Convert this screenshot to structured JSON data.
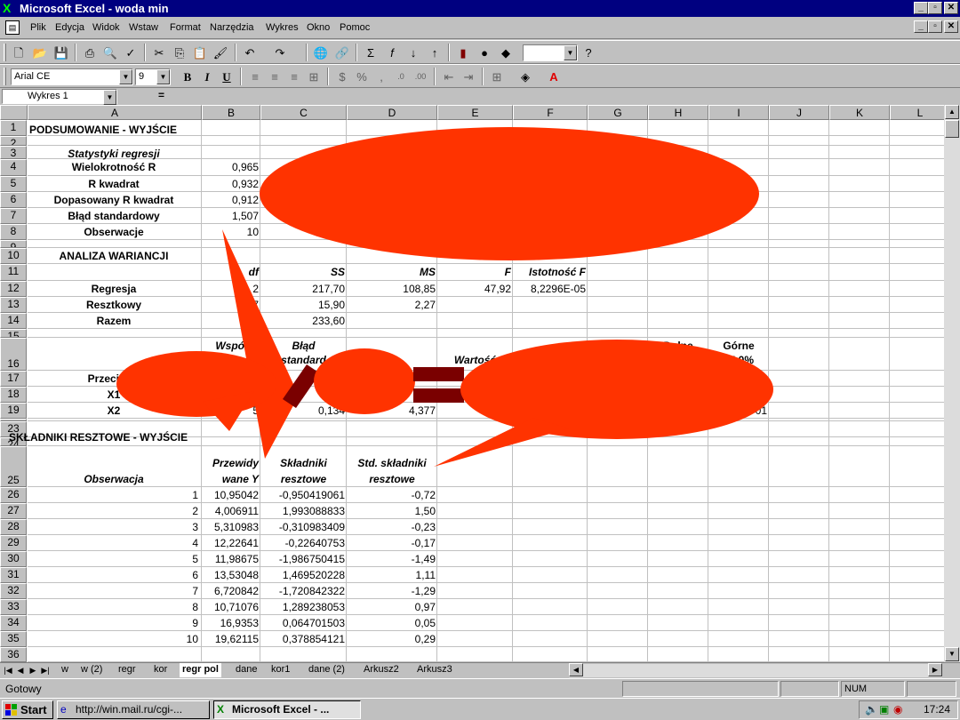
{
  "window": {
    "title": "Microsoft Excel - woda min",
    "minimize": "_",
    "maximize": "▫",
    "close": "✕"
  },
  "menu": [
    "Plik",
    "Edycja",
    "Widok",
    "Wstaw",
    "Format",
    "Narzędzia",
    "Wykres",
    "Okno",
    "Pomoc"
  ],
  "formatting": {
    "font": "Arial CE",
    "size": "9",
    "bold": "B",
    "italic": "I",
    "underline": "U"
  },
  "namebox": "Wykres 1",
  "formula_equals": "=",
  "columns": [
    "A",
    "B",
    "C",
    "D",
    "E",
    "F",
    "G",
    "H",
    "I",
    "J",
    "K",
    "L"
  ],
  "rows": [
    "1",
    "2",
    "3",
    "4",
    "5",
    "6",
    "7",
    "8",
    "9",
    "10",
    "11",
    "12",
    "13",
    "14",
    "15",
    "16",
    "17",
    "18",
    "19",
    "20",
    "23",
    "24",
    "25",
    "26",
    "27",
    "28",
    "29",
    "30",
    "31",
    "32",
    "33",
    "34",
    "35",
    "36"
  ],
  "cells": {
    "a1": "PODSUMOWANIE - WYJŚCIE",
    "a3": "Statystyki regresji",
    "a4": "Wielokrotność R",
    "b4": "0,965",
    "a5": "R kwadrat",
    "b5": "0,932",
    "a6": "Dopasowany R kwadrat",
    "b6": "0,912",
    "a7": "Błąd standardowy",
    "b7": "1,507",
    "a8": "Obserwacje",
    "b8": "10",
    "a10": "ANALIZA WARIANCJI",
    "b11": "df",
    "c11": "SS",
    "d11": "MS",
    "e11": "F",
    "f11": "Istotność F",
    "a12": "Regresja",
    "b12": "2",
    "c12": "217,70",
    "d12": "108,85",
    "e12": "47,92",
    "f12": "8,2296E-05",
    "a13": "Resztkowy",
    "b13": "7",
    "c13": "15,90",
    "d13": "2,27",
    "a14": "Razem",
    "b14": "9",
    "c14": "233,60",
    "b16a": "Współcz",
    "c16a": "Błąd",
    "c16b": "standard",
    "e16": "Wartość",
    "g16": "Górne",
    "h16": "Dolne",
    "i16a": "Górne",
    "i16b": "95,0%",
    "a17": "Przecięcie",
    "a18": "X1",
    "b18": "2,",
    "c18": "21",
    "a19": "X2",
    "b19": "5",
    "c19": "0,134",
    "d19": "4,377",
    "i19": "01",
    "a23": "SKŁADNIKI RESZTOWE - WYJŚCIE",
    "b25a": "Przewidy",
    "b25b": "wane Y",
    "c25a": "Składniki",
    "c25b": "resztowe",
    "d25a": "Std. składniki",
    "d25b": "resztowe",
    "a25": "Obserwacja"
  },
  "residuals": [
    {
      "obs": "1",
      "pred": "10,95042",
      "res": "-0,950419061",
      "std": "-0,72"
    },
    {
      "obs": "2",
      "pred": "4,006911",
      "res": "1,993088833",
      "std": "1,50"
    },
    {
      "obs": "3",
      "pred": "5,310983",
      "res": "-0,310983409",
      "std": "-0,23"
    },
    {
      "obs": "4",
      "pred": "12,22641",
      "res": "-0,22640753",
      "std": "-0,17"
    },
    {
      "obs": "5",
      "pred": "11,98675",
      "res": "-1,986750415",
      "std": "-1,49"
    },
    {
      "obs": "6",
      "pred": "13,53048",
      "res": "1,469520228",
      "std": "1,11"
    },
    {
      "obs": "7",
      "pred": "6,720842",
      "res": "-1,720842322",
      "std": "-1,29"
    },
    {
      "obs": "8",
      "pred": "10,71076",
      "res": "1,289238053",
      "std": "0,97"
    },
    {
      "obs": "9",
      "pred": "16,9353",
      "res": "0,064701503",
      "std": "0,05"
    },
    {
      "obs": "10",
      "pred": "19,62115",
      "res": "0,378854121",
      "std": "0,29"
    }
  ],
  "tabs": [
    "w",
    "w (2)",
    "regr",
    "kor",
    "regr pol",
    "dane",
    "kor1",
    "dane (2)",
    "Arkusz2",
    "Arkusz3"
  ],
  "active_tab": "regr pol",
  "status": {
    "text": "Gotowy",
    "num": "NUM"
  },
  "taskbar": {
    "start": "Start",
    "task1": "http://win.mail.ru/cgi-...",
    "task2": "Microsoft Excel - ...",
    "clock": "17:24"
  },
  "colors": {
    "callout": "#ff3300",
    "marks": "#7a0000",
    "titlebar": "#000080"
  }
}
